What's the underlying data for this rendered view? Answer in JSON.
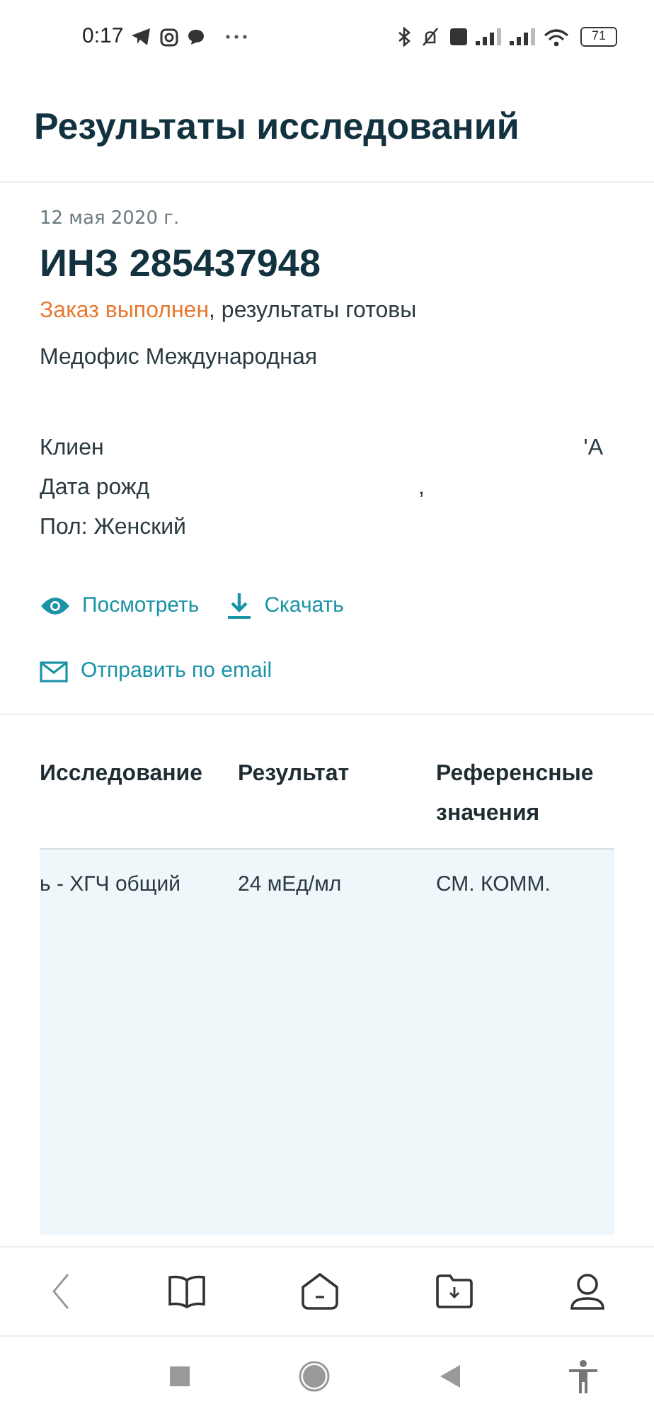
{
  "status_bar": {
    "time": "0:17",
    "battery": "71"
  },
  "title": "Результаты исследований",
  "order": {
    "date": "12 мая 2020 г.",
    "number": "ИНЗ 285437948",
    "status": "Заказ выполнен",
    "status_rest": ", результаты готовы",
    "office": "Медофис Международная",
    "client_label": "Клиен",
    "client_tail": "'А",
    "birth_label": "Дата рожд",
    "birth_tail": ",",
    "sex": "Пол: Женский"
  },
  "actions": [
    {
      "kind": "view",
      "label": "Посмотреть"
    },
    {
      "kind": "download",
      "label": "Скачать"
    }
  ],
  "email_action": "Отправить по email",
  "table": {
    "columns": [
      "Исследование",
      "Результат",
      "Референсные значения"
    ],
    "rows": [
      {
        "cells": [
          "ь - ХГЧ общий",
          "24 мЕд/мл",
          "СМ. КОММ."
        ]
      }
    ]
  },
  "bottom_nav": [
    {
      "kind": "back"
    },
    {
      "kind": "book"
    },
    {
      "kind": "home"
    },
    {
      "kind": "folder"
    },
    {
      "kind": "profile"
    }
  ]
}
